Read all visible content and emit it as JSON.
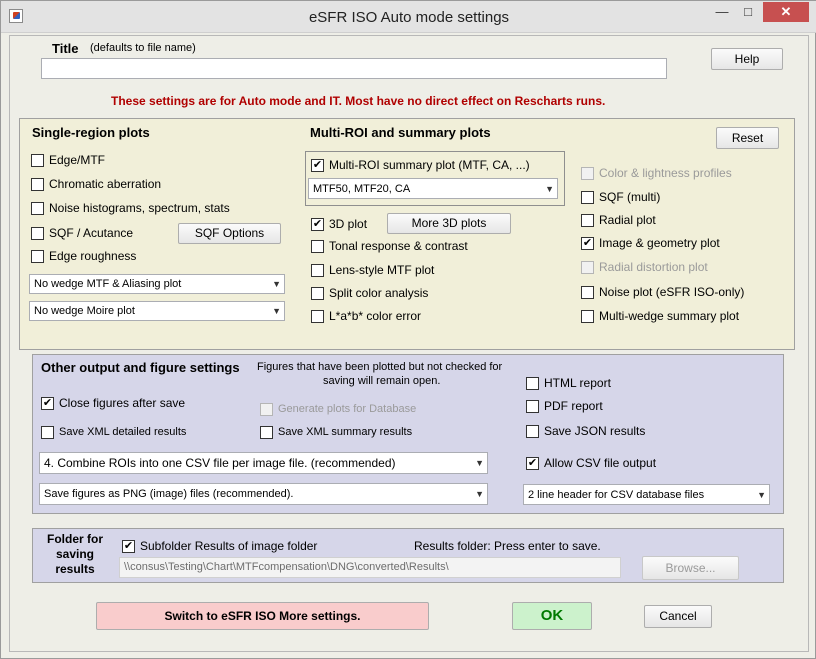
{
  "window": {
    "title": "eSFR ISO Auto mode settings",
    "controls": {
      "minimize": "—",
      "maximize": "□",
      "close": "✕"
    }
  },
  "header": {
    "title_label": "Title",
    "title_hint": "(defaults to file name)",
    "title_value": "",
    "help_label": "Help",
    "notice": "These settings are for Auto mode and IT. Most have no direct effect on Rescharts runs."
  },
  "single_region": {
    "heading": "Single-region plots",
    "items": [
      {
        "label": "Edge/MTF",
        "checked": false
      },
      {
        "label": "Chromatic aberration",
        "checked": false
      },
      {
        "label": "Noise histograms, spectrum, stats",
        "checked": false
      },
      {
        "label": "SQF / Acutance",
        "checked": false
      },
      {
        "label": "Edge roughness",
        "checked": false
      }
    ],
    "sqf_options_label": "SQF Options",
    "wedge_mtf_select": "No wedge MTF & Aliasing plot",
    "wedge_moire_select": "No wedge Moire plot"
  },
  "multi_roi": {
    "heading": "Multi-ROI and summary plots",
    "reset_label": "Reset",
    "summary_plot": {
      "label": "Multi-ROI summary plot (MTF, CA, ...)",
      "checked": true
    },
    "summary_select": "MTF50, MTF20, CA",
    "plot3d": {
      "label": "3D plot",
      "checked": true
    },
    "more_3d_label": "More 3D plots",
    "items": [
      {
        "label": "Tonal response & contrast",
        "checked": false
      },
      {
        "label": "Lens-style MTF plot",
        "checked": false
      },
      {
        "label": "Split color analysis",
        "checked": false
      },
      {
        "label": "L*a*b* color error",
        "checked": false
      }
    ],
    "right_items": [
      {
        "label": "Color & lightness profiles",
        "checked": false,
        "disabled": true
      },
      {
        "label": "SQF (multi)",
        "checked": false,
        "disabled": false
      },
      {
        "label": "Radial plot",
        "checked": false,
        "disabled": false
      },
      {
        "label": "Image & geometry plot",
        "checked": true,
        "disabled": false
      },
      {
        "label": "Radial distortion plot",
        "checked": false,
        "disabled": true
      },
      {
        "label": "Noise plot  (eSFR ISO-only)",
        "checked": false,
        "disabled": false
      },
      {
        "label": "Multi-wedge summary plot",
        "checked": false,
        "disabled": false
      }
    ]
  },
  "output": {
    "heading": "Other output and figure settings",
    "note_line1": "Figures that have been plotted but not checked for",
    "note_line2": "saving will remain open.",
    "close_figures": {
      "label": "Close figures after save",
      "checked": true
    },
    "generate_db": {
      "label": "Generate plots for Database",
      "checked": false,
      "disabled": true
    },
    "save_xml_detailed": {
      "label": "Save XML detailed results",
      "checked": false
    },
    "save_xml_summary": {
      "label": "Save XML summary results",
      "checked": false
    },
    "html_report": {
      "label": "HTML report",
      "checked": false
    },
    "pdf_report": {
      "label": "PDF report",
      "checked": false
    },
    "save_json": {
      "label": "Save JSON results",
      "checked": false
    },
    "allow_csv": {
      "label": "Allow CSV file output",
      "checked": true
    },
    "combine_select": "4. Combine ROIs into one CSV file per image file.  (recommended)",
    "figures_select": "Save figures as PNG (image) files (recommended).",
    "csv_header_select": "2 line header for CSV database files"
  },
  "folder": {
    "heading_line1": "Folder for",
    "heading_line2": "saving",
    "heading_line3": "results",
    "subfolder": {
      "label": "Subfolder Results of image folder",
      "checked": true
    },
    "results_hint": "Results folder:  Press enter to save.",
    "path": "\\\\consus\\Testing\\Chart\\MTFcompensation\\DNG\\converted\\Results\\",
    "browse_label": "Browse..."
  },
  "footer": {
    "switch_label": "Switch to eSFR ISO More settings.",
    "ok_label": "OK",
    "cancel_label": "Cancel"
  },
  "colors": {
    "notice_red": "#b00000",
    "yellow_panel": "#f1efd9",
    "lavender_panel": "#d6d6e9",
    "switch_pink": "#f9cccc",
    "ok_green": "#ccf2cc",
    "ok_text": "#007a00",
    "close_button": "#c75050"
  }
}
